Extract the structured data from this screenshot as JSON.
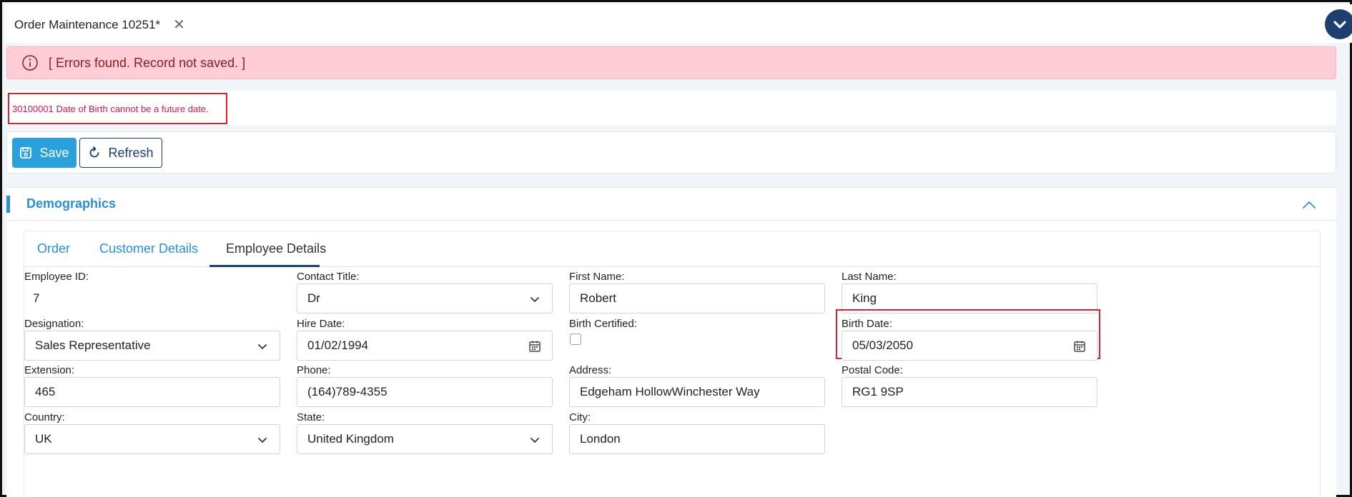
{
  "window": {
    "tab_title": "Order Maintenance 10251*",
    "close_glyph": "✕",
    "collapse_icon": "chevron-down-icon"
  },
  "error_banner": {
    "icon": "info-icon",
    "message": "[ Errors found. Record not saved. ]",
    "bg_color": "#fecdd6"
  },
  "validation": {
    "message": "30100001 Date of Birth cannot be a future date."
  },
  "toolbar": {
    "save_label": "Save",
    "refresh_label": "Refresh",
    "save_color": "#2aa0dd"
  },
  "panel": {
    "title": "Demographics",
    "accent_color": "#2a8fd6"
  },
  "tabs": [
    {
      "label": "Order",
      "active": false
    },
    {
      "label": "Customer Details",
      "active": false
    },
    {
      "label": "Employee Details",
      "active": true
    }
  ],
  "fields": {
    "employee_id": {
      "label": "Employee ID:",
      "value": "7"
    },
    "contact_title": {
      "label": "Contact Title:",
      "value": "Dr"
    },
    "first_name": {
      "label": "First Name:",
      "value": "Robert"
    },
    "last_name": {
      "label": "Last Name:",
      "value": "King"
    },
    "designation": {
      "label": "Designation:",
      "value": "Sales Representative"
    },
    "hire_date": {
      "label": "Hire Date:",
      "value": "01/02/1994"
    },
    "birth_certified": {
      "label": "Birth Certified:",
      "checked": false
    },
    "birth_date": {
      "label": "Birth Date:",
      "value": "05/03/2050"
    },
    "extension": {
      "label": "Extension:",
      "value": "465"
    },
    "phone": {
      "label": "Phone:",
      "value": "(164)789-4355"
    },
    "address": {
      "label": "Address:",
      "value": "Edgeham HollowWinchester Way"
    },
    "postal_code": {
      "label": "Postal Code:",
      "value": "RG1 9SP"
    },
    "country": {
      "label": "Country:",
      "value": "UK"
    },
    "state": {
      "label": "State:",
      "value": "United Kingdom"
    },
    "city": {
      "label": "City:",
      "value": "London"
    }
  }
}
